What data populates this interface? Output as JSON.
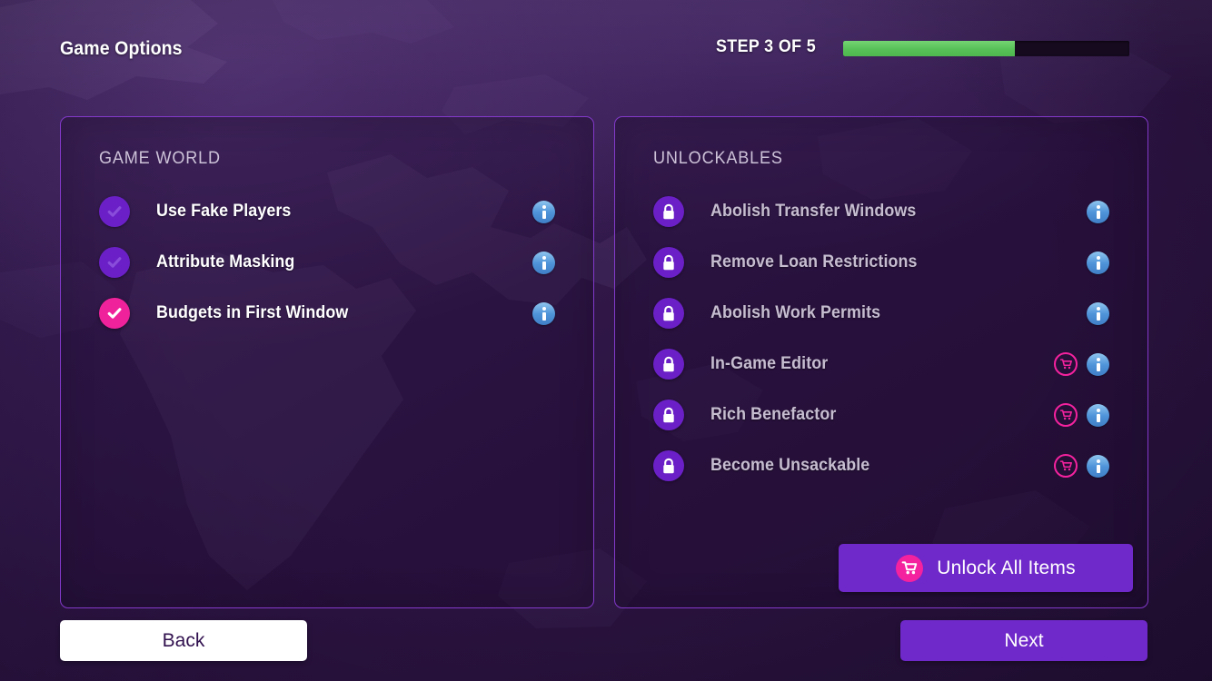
{
  "header": {
    "title": "Game Options",
    "step_label": "STEP 3 OF 5",
    "progress_percent": 60,
    "progress_fill_color": "#57c057",
    "progress_track_color": "#150a1e"
  },
  "theme": {
    "background_purple": "#351b50",
    "panel_border": "#8239c9",
    "accent_purple": "#6f28c9",
    "accent_pink": "#f0229b",
    "info_blue": "#4f93d9",
    "text_white": "#ffffff",
    "text_dim": "#c6bdd0"
  },
  "panels": [
    {
      "id": "game-world",
      "title": "GAME WORLD",
      "rows": [
        {
          "label": "Use Fake Players",
          "checked": false,
          "has_info": true,
          "has_cart": false
        },
        {
          "label": "Attribute Masking",
          "checked": false,
          "has_info": true,
          "has_cart": false
        },
        {
          "label": "Budgets in First Window",
          "checked": true,
          "has_info": true,
          "has_cart": false
        }
      ]
    },
    {
      "id": "unlockables",
      "title": "UNLOCKABLES",
      "rows": [
        {
          "label": "Abolish Transfer Windows",
          "locked": true,
          "has_info": true,
          "has_cart": false
        },
        {
          "label": "Remove Loan Restrictions",
          "locked": true,
          "has_info": true,
          "has_cart": false
        },
        {
          "label": "Abolish Work Permits",
          "locked": true,
          "has_info": true,
          "has_cart": false
        },
        {
          "label": "In-Game Editor",
          "locked": true,
          "has_info": true,
          "has_cart": true
        },
        {
          "label": "Rich Benefactor",
          "locked": true,
          "has_info": true,
          "has_cart": true
        },
        {
          "label": "Become Unsackable",
          "locked": true,
          "has_info": true,
          "has_cart": true
        }
      ],
      "unlock_all_label": "Unlock All Items"
    }
  ],
  "footer": {
    "back_label": "Back",
    "next_label": "Next"
  },
  "icons": {
    "check": "check-icon",
    "lock": "lock-icon",
    "info": "info-icon",
    "cart": "shopping-cart-icon"
  }
}
